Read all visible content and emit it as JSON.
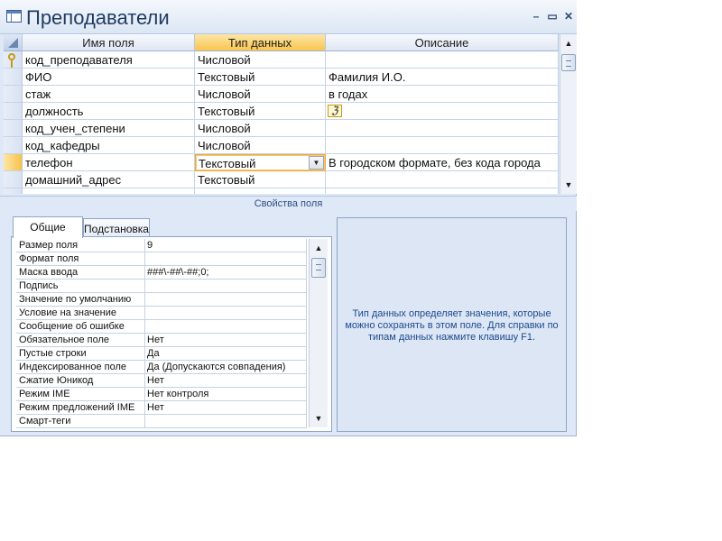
{
  "window": {
    "title": "Преподаватели"
  },
  "grid": {
    "headers": {
      "field_name": "Имя поля",
      "data_type": "Тип данных",
      "description": "Описание"
    },
    "rows": [
      {
        "name": "код_преподавателя",
        "type": "Числовой",
        "description": "",
        "is_key": true
      },
      {
        "name": "ФИО",
        "type": "Текстовый",
        "description": "Фамилия И.О."
      },
      {
        "name": "стаж",
        "type": "Числовой",
        "description": "в годах"
      },
      {
        "name": "должность",
        "type": "Текстовый",
        "description": ""
      },
      {
        "name": "код_учен_степени",
        "type": "Числовой",
        "description": ""
      },
      {
        "name": "код_кафедры",
        "type": "Числовой",
        "description": ""
      },
      {
        "name": "телефон",
        "type": "Текстовый",
        "description": "В городском формате, без кода города",
        "active": true
      },
      {
        "name": "домашний_адрес",
        "type": "Текстовый",
        "description": ""
      }
    ]
  },
  "properties": {
    "section_title": "Свойства поля",
    "tabs": [
      "Общие",
      "Подстановка"
    ],
    "rows": [
      {
        "label": "Размер поля",
        "value": "9"
      },
      {
        "label": "Формат поля",
        "value": ""
      },
      {
        "label": "Маска ввода",
        "value": "###\\-##\\-##;0;"
      },
      {
        "label": "Подпись",
        "value": ""
      },
      {
        "label": "Значение по умолчанию",
        "value": ""
      },
      {
        "label": "Условие на значение",
        "value": ""
      },
      {
        "label": "Сообщение об ошибке",
        "value": ""
      },
      {
        "label": "Обязательное поле",
        "value": "Нет"
      },
      {
        "label": "Пустые строки",
        "value": "Да"
      },
      {
        "label": "Индексированное поле",
        "value": "Да (Допускаются совпадения)"
      },
      {
        "label": "Сжатие Юникод",
        "value": "Нет"
      },
      {
        "label": "Режим IME",
        "value": "Нет контроля"
      },
      {
        "label": "Режим предложений IME",
        "value": "Нет"
      },
      {
        "label": "Смарт-теги",
        "value": ""
      }
    ],
    "help_text": "Тип данных определяет значения, которые можно сохранять в этом поле.  Для справки по типам данных нажмите клавишу F1."
  },
  "icons": {
    "title_icon": "table-icon",
    "minimize": "minimize-icon",
    "restore": "restore-icon",
    "close": "close-icon",
    "primary_key": "key-icon",
    "builder": "builder-icon"
  },
  "colors": {
    "accent_selected": "#f9c54e",
    "help_text": "#1d4a8f",
    "window_bg": "#dfe8f6"
  }
}
